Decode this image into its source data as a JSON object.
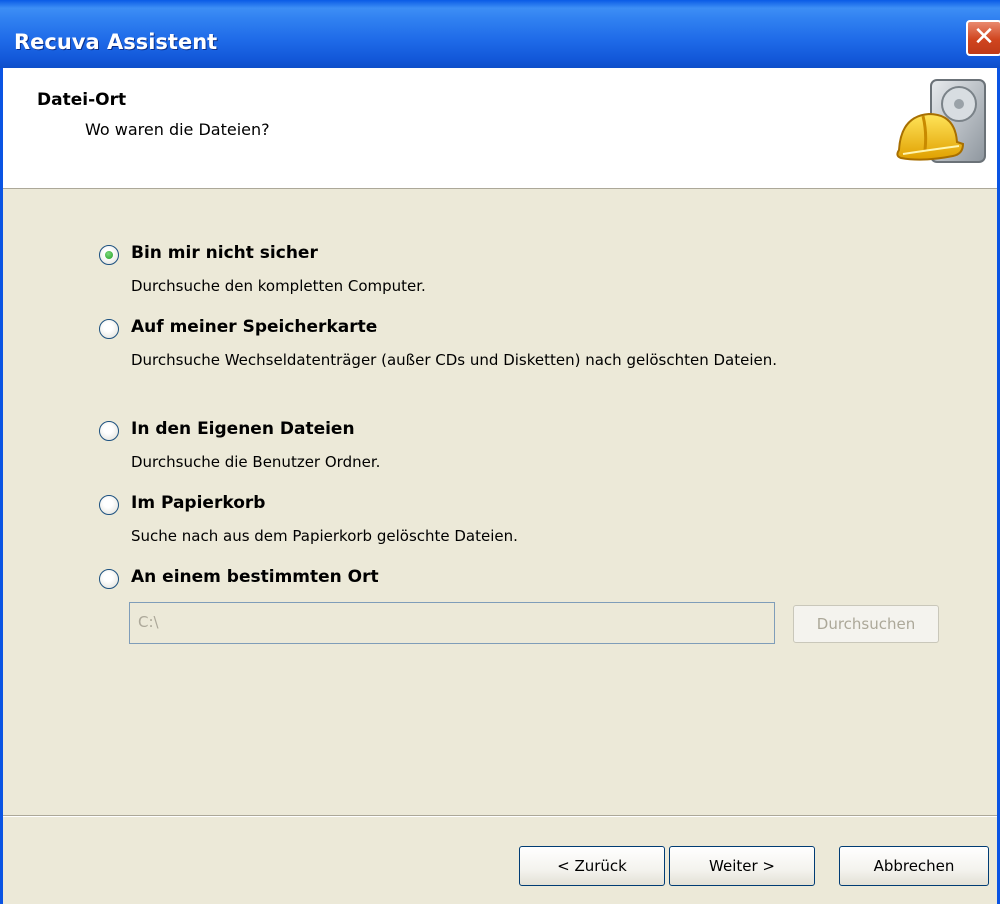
{
  "window": {
    "title": "Recuva Assistent",
    "close_glyph": "✕"
  },
  "header": {
    "title": "Datei-Ort",
    "subtitle": "Wo waren die Dateien?",
    "icon": "hard-drive-helmet-icon"
  },
  "options": [
    {
      "label": "Bin mir nicht sicher",
      "description": "Durchsuche den kompletten Computer.",
      "selected": true
    },
    {
      "label": "Auf meiner Speicherkarte",
      "description": "Durchsuche Wechseldatenträger (außer CDs und Disketten) nach gelöschten Dateien.",
      "selected": false
    },
    {
      "label": "In den Eigenen Dateien",
      "description": "Durchsuche die Benutzer Ordner.",
      "selected": false
    },
    {
      "label": "Im Papierkorb",
      "description": "Suche nach aus dem Papierkorb gelöschte Dateien.",
      "selected": false
    },
    {
      "label": "An einem bestimmten Ort",
      "description": "",
      "selected": false
    }
  ],
  "location": {
    "path_value": "C:\\",
    "browse_label": "Durchsuchen"
  },
  "buttons": {
    "back": "< Zurück",
    "next": "Weiter >",
    "cancel": "Abbrechen"
  },
  "colors": {
    "titlebar": "#0a54e3",
    "dialog_bg": "#ece9d8",
    "radio_selected": "#21a121"
  }
}
